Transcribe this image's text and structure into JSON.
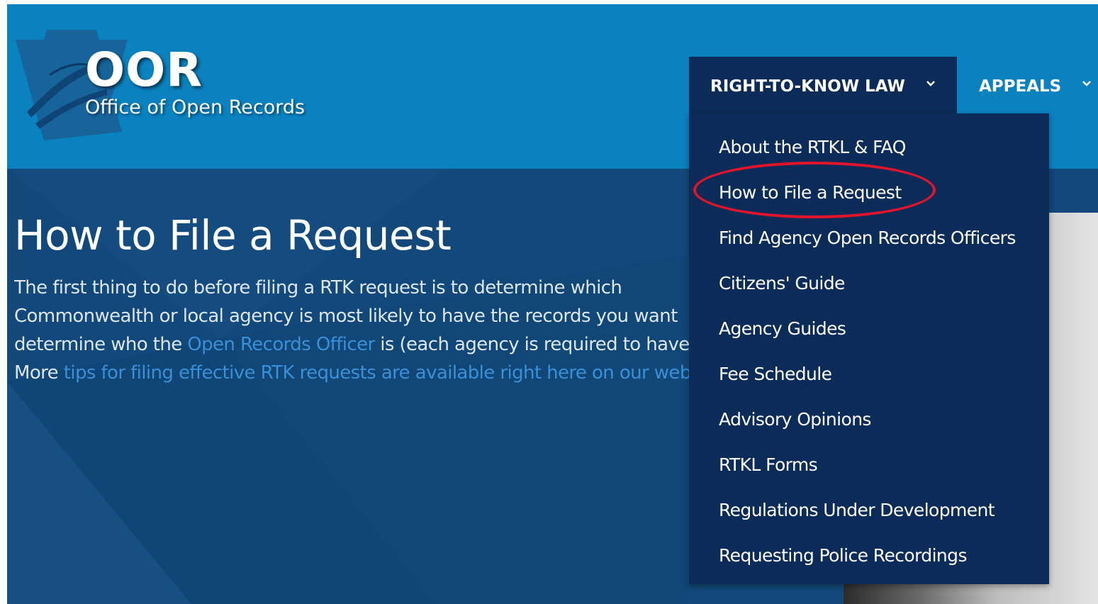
{
  "logo": {
    "acronym": "OOR",
    "subtitle": "Office of Open Records"
  },
  "nav": {
    "items": [
      {
        "label": "RIGHT-TO-KNOW LAW",
        "active": true
      },
      {
        "label": "APPEALS",
        "active": false
      }
    ]
  },
  "dropdown": {
    "items": [
      {
        "label": "About the RTKL & FAQ"
      },
      {
        "label": "How to File a Request",
        "highlighted": true
      },
      {
        "label": "Find Agency Open Records Officers"
      },
      {
        "label": "Citizens' Guide"
      },
      {
        "label": "Agency Guides"
      },
      {
        "label": "Fee Schedule"
      },
      {
        "label": "Advisory Opinions"
      },
      {
        "label": "RTKL Forms"
      },
      {
        "label": "Regulations Under Development"
      },
      {
        "label": "Requesting Police Recordings"
      }
    ]
  },
  "main": {
    "title": "How to File a Request",
    "intro": {
      "line1": "The first thing to do before filing a RTK request is to determine which",
      "line2": "Commonwealth or local agency is most likely to have the records you want",
      "line3_a": "determine who the ",
      "line3_link": "Open Records Officer",
      "line3_b": " is (each agency is required to have",
      "line4_a": "More ",
      "line4_link": "tips for filing effective RTK requests are available right here on our website"
    }
  },
  "colors": {
    "header_bg": "#0a82c0",
    "nav_dark": "#0b2c59",
    "content_bg": "#12497a",
    "link": "#3a8fd6",
    "highlight_circle": "#e0142a"
  }
}
